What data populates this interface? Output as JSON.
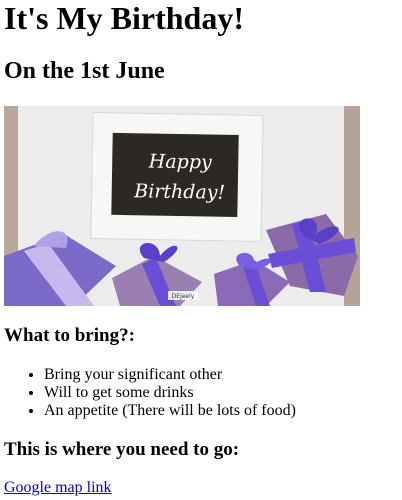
{
  "header": {
    "title": "It's My Birthday!",
    "subtitle": "On the 1st June"
  },
  "hero_image": {
    "chalkboard_line1": "Happy",
    "chalkboard_line2": "Birthday!",
    "watermark": "DEjeely",
    "colors": {
      "board": "#2b2826",
      "frame": "#f4f4f2",
      "background": "#e9e9e9",
      "wood": "#b8a79a",
      "gift_purple": "#7b6ac8",
      "gift_mauve": "#9a7fb0",
      "ribbon": "#6a4fd6"
    }
  },
  "bring_section": {
    "heading": "What to bring?:",
    "items": [
      "Bring your significant other",
      "Will to get some drinks",
      "An appetite (There will be lots of food)"
    ]
  },
  "location_section": {
    "heading": "This is where you need to go:",
    "link_text": "Google map link"
  }
}
